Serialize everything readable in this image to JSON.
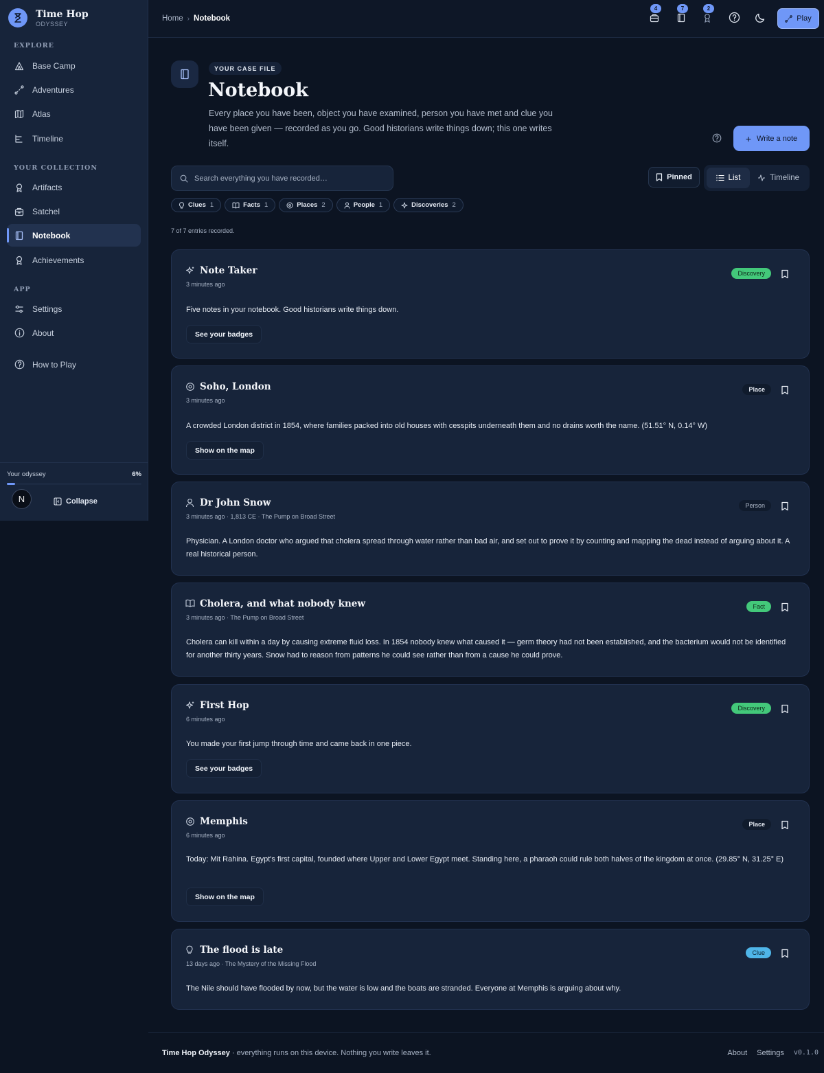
{
  "app": {
    "name": "Time Hop",
    "subtitle": "ODYSSEY"
  },
  "sidebar": {
    "sections": [
      {
        "label": "EXPLORE"
      },
      {
        "label": "YOUR COLLECTION"
      },
      {
        "label": "APP"
      }
    ],
    "items": [
      {
        "label": "Base Camp",
        "icon": "tent-icon"
      },
      {
        "label": "Adventures",
        "icon": "route-icon"
      },
      {
        "label": "Atlas",
        "icon": "map-icon"
      },
      {
        "label": "Timeline",
        "icon": "timeline-icon"
      },
      {
        "label": "Artifacts",
        "icon": "gem-icon"
      },
      {
        "label": "Satchel",
        "icon": "satchel-icon"
      },
      {
        "label": "Notebook",
        "icon": "notebook-icon",
        "active": true
      },
      {
        "label": "Achievements",
        "icon": "award-icon"
      },
      {
        "label": "Settings",
        "icon": "sliders-icon"
      },
      {
        "label": "About",
        "icon": "info-icon"
      },
      {
        "label": "How to Play",
        "icon": "help-icon"
      }
    ],
    "progress": {
      "label": "Your odyssey",
      "value_text": "6%",
      "value": 0.06
    },
    "avatar_letter": "N",
    "collapse_label": "Collapse"
  },
  "header": {
    "breadcrumb": {
      "home": "Home",
      "separator": "›",
      "current": "Notebook"
    },
    "badges": {
      "satchel": "4",
      "notebook": "7",
      "achievements": "2"
    },
    "play_label": "Play"
  },
  "page": {
    "eyebrow": "YOUR CASE FILE",
    "title": "Notebook",
    "description": "Every place you have been, object you have examined, person you have met and clue you have been given — recorded as you go. Good historians write things down; this one writes itself.",
    "write_label": "Write a note",
    "search_placeholder": "Search everything you have recorded…",
    "pinned_label": "Pinned",
    "view_list_label": "List",
    "view_timeline_label": "Timeline",
    "filters": [
      {
        "label": "Clues",
        "count": "1",
        "icon": "bulb-icon"
      },
      {
        "label": "Facts",
        "count": "1",
        "icon": "book-icon"
      },
      {
        "label": "Places",
        "count": "2",
        "icon": "pin-icon"
      },
      {
        "label": "People",
        "count": "1",
        "icon": "person-icon"
      },
      {
        "label": "Discoveries",
        "count": "2",
        "icon": "sparkle-icon"
      }
    ],
    "count_text": "7 of 7 entries recorded."
  },
  "entries": [
    {
      "title": "Note Taker",
      "meta": "3 minutes ago",
      "tag": "Discovery",
      "body": "Five notes in your notebook. Good historians write things down.",
      "action": "See your badges"
    },
    {
      "title": "Soho, London",
      "meta": "3 minutes ago",
      "tag": "Place",
      "body": "A crowded London district in 1854, where families packed into old houses with cesspits underneath them and no drains worth the name. (51.51° N, 0.14° W)",
      "action": "Show on the map"
    },
    {
      "title": "Dr John Snow",
      "meta": "3 minutes ago · 1,813 CE · The Pump on Broad Street",
      "tag": "Person",
      "body": "Physician. A London doctor who argued that cholera spread through water rather than bad air, and set out to prove it by counting and mapping the dead instead of arguing about it. A real historical person."
    },
    {
      "title": "Cholera, and what nobody knew",
      "meta": "3 minutes ago · The Pump on Broad Street",
      "tag": "Fact",
      "body": "Cholera can kill within a day by causing extreme fluid loss. In 1854 nobody knew what caused it — germ theory had not been established, and the bacterium would not be identified for another thirty years. Snow had to reason from patterns he could see rather than from a cause he could prove."
    },
    {
      "title": "First Hop",
      "meta": "6 minutes ago",
      "tag": "Discovery",
      "body": "You made your first jump through time and came back in one piece.",
      "action": "See your badges"
    },
    {
      "title": "Memphis",
      "meta": "6 minutes ago",
      "tag": "Place",
      "body": "Today: Mit Rahina. Egypt's first capital, founded where Upper and Lower Egypt meet. Standing here, a pharaoh could rule both halves of the kingdom at once. (29.85° N, 31.25° E)",
      "action": "Show on the map"
    },
    {
      "title": "The flood is late",
      "meta": "13 days ago · The Mystery of the Missing Flood",
      "tag": "Clue",
      "body": "The Nile should have flooded by now, but the water is low and the boats are stranded. Everyone at Memphis is arguing about why."
    }
  ],
  "footer": {
    "brand": "Time Hop Odyssey",
    "tagline": " · everything runs on this device. Nothing you write leaves it.",
    "about": "About",
    "settings": "Settings",
    "version": "v0.1.0"
  }
}
